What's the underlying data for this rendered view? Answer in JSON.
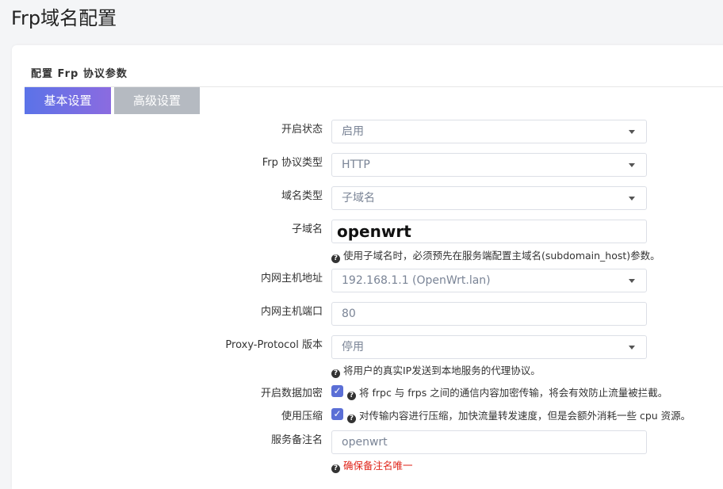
{
  "page": {
    "title": "Frp域名配置"
  },
  "section": {
    "title": "配置 Frp 协议参数"
  },
  "tabs": [
    {
      "label": "基本设置",
      "active": true
    },
    {
      "label": "高级设置",
      "active": false
    }
  ],
  "form": {
    "enable": {
      "label": "开启状态",
      "value": "启用"
    },
    "protocol": {
      "label": "Frp 协议类型",
      "value": "HTTP"
    },
    "domain_type": {
      "label": "域名类型",
      "value": "子域名"
    },
    "subdomain": {
      "label": "子域名",
      "value": "openwrt",
      "help": "使用子域名时，必须预先在服务端配置主域名(subdomain_host)参数。"
    },
    "local_ip": {
      "label": "内网主机地址",
      "value": "192.168.1.1 (OpenWrt.lan)"
    },
    "local_port": {
      "label": "内网主机端口",
      "value": "80"
    },
    "proxy_protocol": {
      "label": "Proxy-Protocol 版本",
      "value": "停用",
      "help": "将用户的真实IP发送到本地服务的代理协议。"
    },
    "encryption": {
      "label": "开启数据加密",
      "checked": true,
      "help": "将 frpc 与 frps 之间的通信内容加密传输，将会有效防止流量被拦截。"
    },
    "compression": {
      "label": "使用压缩",
      "checked": true,
      "help": "对传输内容进行压缩，加快流量转发速度，但是会额外消耗一些 cpu 资源。"
    },
    "remark": {
      "label": "服务备注名",
      "value": "openwrt",
      "help": "确保备注名唯一"
    }
  },
  "icons": {
    "help": "question-circle-icon",
    "dropdown": "caret-down-icon",
    "check": "checkmark-icon"
  },
  "colors": {
    "tab_active_start": "#5b73e8",
    "tab_active_end": "#8b6be0",
    "tab_inactive": "#b5bac1",
    "checkbox": "#5b6fd6",
    "warning_text": "#e0261b"
  }
}
